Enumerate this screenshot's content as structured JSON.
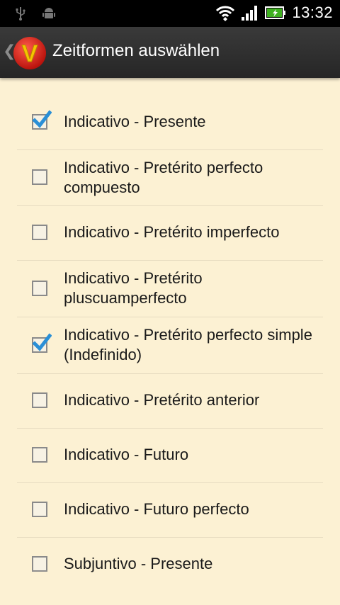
{
  "status": {
    "time": "13:32",
    "left_icons": [
      "usb-icon",
      "android-debug-icon"
    ],
    "right_icons": [
      "wifi-icon",
      "signal-icon",
      "battery-icon"
    ]
  },
  "action_bar": {
    "title": "Zeitformen auswählen",
    "logo_letter": "V"
  },
  "items": [
    {
      "label": "Indicativo - Presente",
      "checked": true
    },
    {
      "label": "Indicativo - Pretérito perfecto compuesto",
      "checked": false
    },
    {
      "label": "Indicativo - Pretérito imperfecto",
      "checked": false
    },
    {
      "label": "Indicativo - Pretérito pluscuamperfecto",
      "checked": false
    },
    {
      "label": "Indicativo - Pretérito perfecto simple (Indefinido)",
      "checked": true
    },
    {
      "label": "Indicativo - Pretérito anterior",
      "checked": false
    },
    {
      "label": "Indicativo - Futuro",
      "checked": false
    },
    {
      "label": "Indicativo - Futuro perfecto",
      "checked": false
    },
    {
      "label": "Subjuntivo - Presente",
      "checked": false
    }
  ],
  "colors": {
    "check": "#2a8fd6",
    "background": "#fcf1d3"
  }
}
